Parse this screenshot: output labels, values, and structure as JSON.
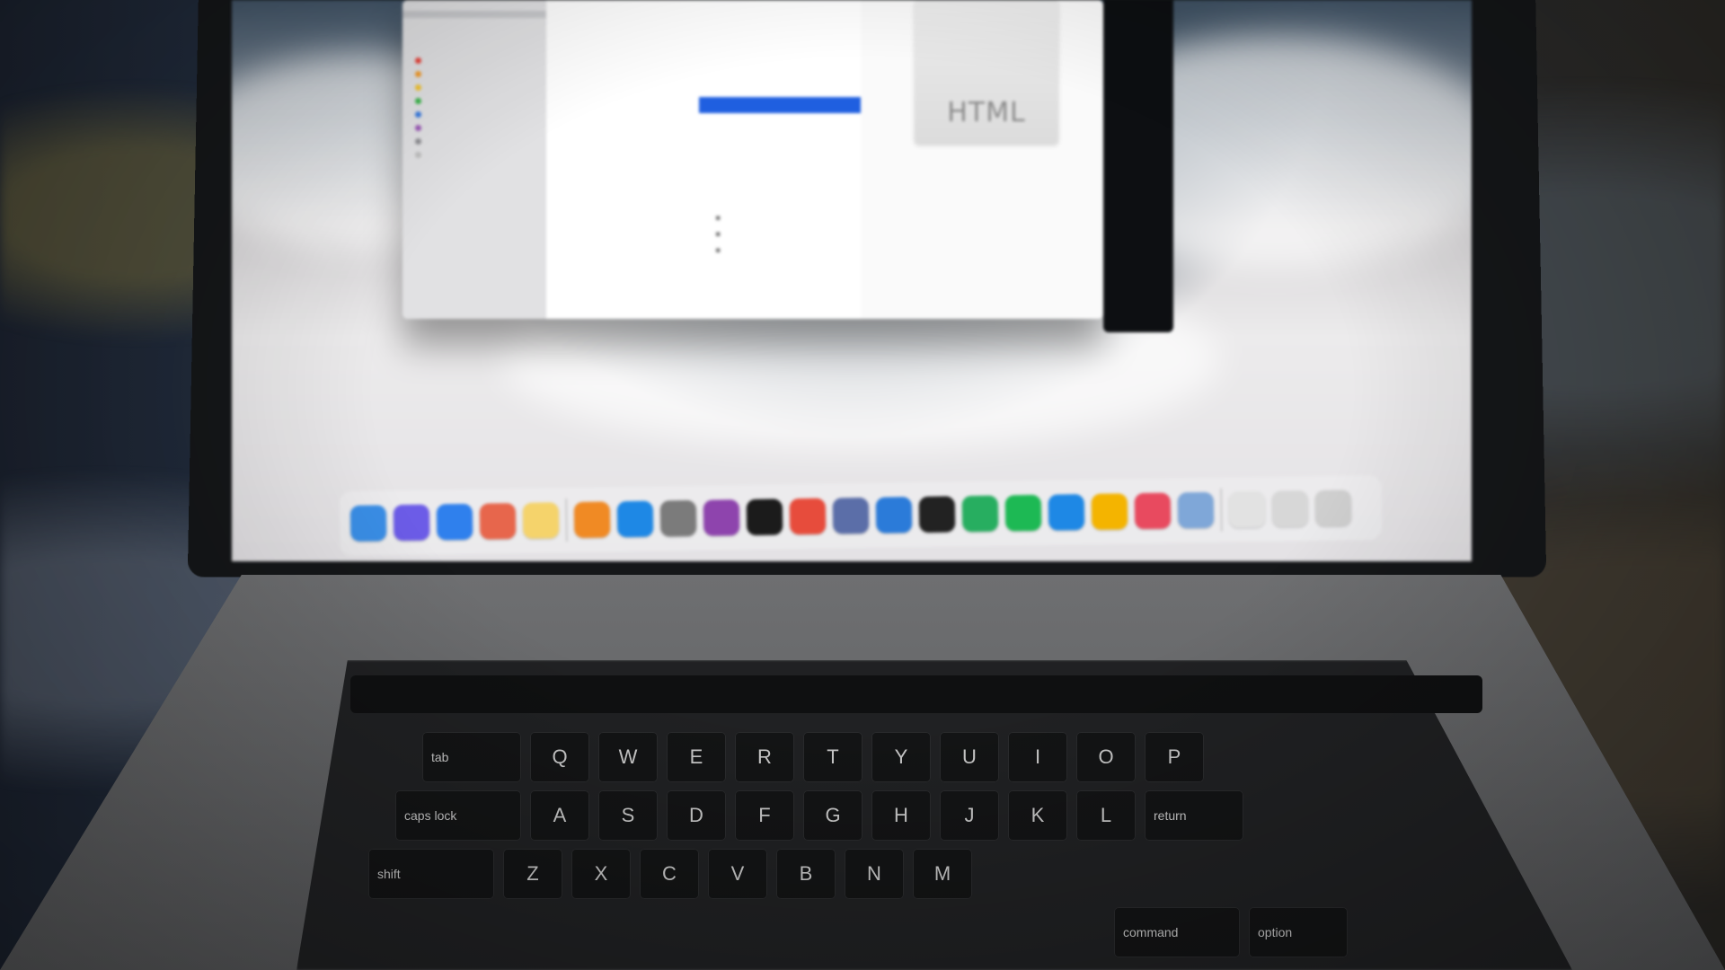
{
  "finder": {
    "sidebar_items": [
      "",
      "",
      ""
    ],
    "sidebar_section": "",
    "sidebar_location": "",
    "tags_header": "",
    "tags": [
      {
        "color": "#e8453c"
      },
      {
        "color": "#f39c2b"
      },
      {
        "color": "#f2c431"
      },
      {
        "color": "#3bb54a"
      },
      {
        "color": "#3a7be0"
      },
      {
        "color": "#9b59b6"
      },
      {
        "color": "#8e8e93"
      },
      {
        "color": "#bdbdbd"
      }
    ],
    "file_rows": 13,
    "selected_row_index": 6,
    "preview": {
      "doc_type_label": "HTML",
      "info_lines": [
        "",
        "",
        "",
        "",
        ""
      ]
    }
  },
  "terminal": {
    "lines": [
      "",
      "",
      "",
      "",
      "",
      "",
      ""
    ]
  },
  "dock": {
    "icons": [
      {
        "name": "finder-icon",
        "color": "#3a8ee6"
      },
      {
        "name": "siri-icon",
        "color": "#6c5ce7"
      },
      {
        "name": "safari-icon",
        "color": "#2f80ed"
      },
      {
        "name": "launchpad-icon",
        "color": "#e7664c"
      },
      {
        "name": "notes-icon",
        "color": "#f5d36b"
      },
      {
        "name": "separator-like-icon",
        "color": "#c7c7c7"
      },
      {
        "name": "books-icon",
        "color": "#f08a24"
      },
      {
        "name": "app-store-icon",
        "color": "#1e88e5"
      },
      {
        "name": "screenshot-icon",
        "color": "#7b7b7b"
      },
      {
        "name": "podcasts-icon",
        "color": "#8e44ad"
      },
      {
        "name": "tv-icon",
        "color": "#1b1b1b"
      },
      {
        "name": "music-icon",
        "color": "#e74c3c"
      },
      {
        "name": "photo-app-icon",
        "color": "#5b6ea8"
      },
      {
        "name": "xcode-icon",
        "color": "#2b7bd9"
      },
      {
        "name": "terminal-icon",
        "color": "#222222"
      },
      {
        "name": "whatsapp-icon",
        "color": "#27ae60"
      },
      {
        "name": "spotify-icon",
        "color": "#1db954"
      },
      {
        "name": "vscode-icon",
        "color": "#1e88e5"
      },
      {
        "name": "chrome-icon",
        "color": "#f4b400"
      },
      {
        "name": "flashcards-icon",
        "color": "#e84a5f"
      },
      {
        "name": "preview-icon",
        "color": "#7fa7d8"
      },
      {
        "name": "document-icon",
        "color": "#e2e2e2"
      },
      {
        "name": "downloads-icon",
        "color": "#d7d7d7"
      },
      {
        "name": "trash-icon",
        "color": "#cfcfcf"
      }
    ]
  },
  "keyboard": {
    "row1": [
      "Q",
      "W",
      "E",
      "R",
      "T",
      "Y",
      "U",
      "I",
      "O",
      "P"
    ],
    "row2": [
      "A",
      "S",
      "D",
      "F",
      "G",
      "H",
      "J",
      "K",
      "L"
    ],
    "row3": [
      "Z",
      "X",
      "C",
      "V",
      "B",
      "N",
      "M"
    ],
    "tab_label": "tab",
    "caps_label": "caps lock",
    "shift_label": "shift",
    "command_label": "command",
    "option_label": "option",
    "return_label": "return"
  }
}
